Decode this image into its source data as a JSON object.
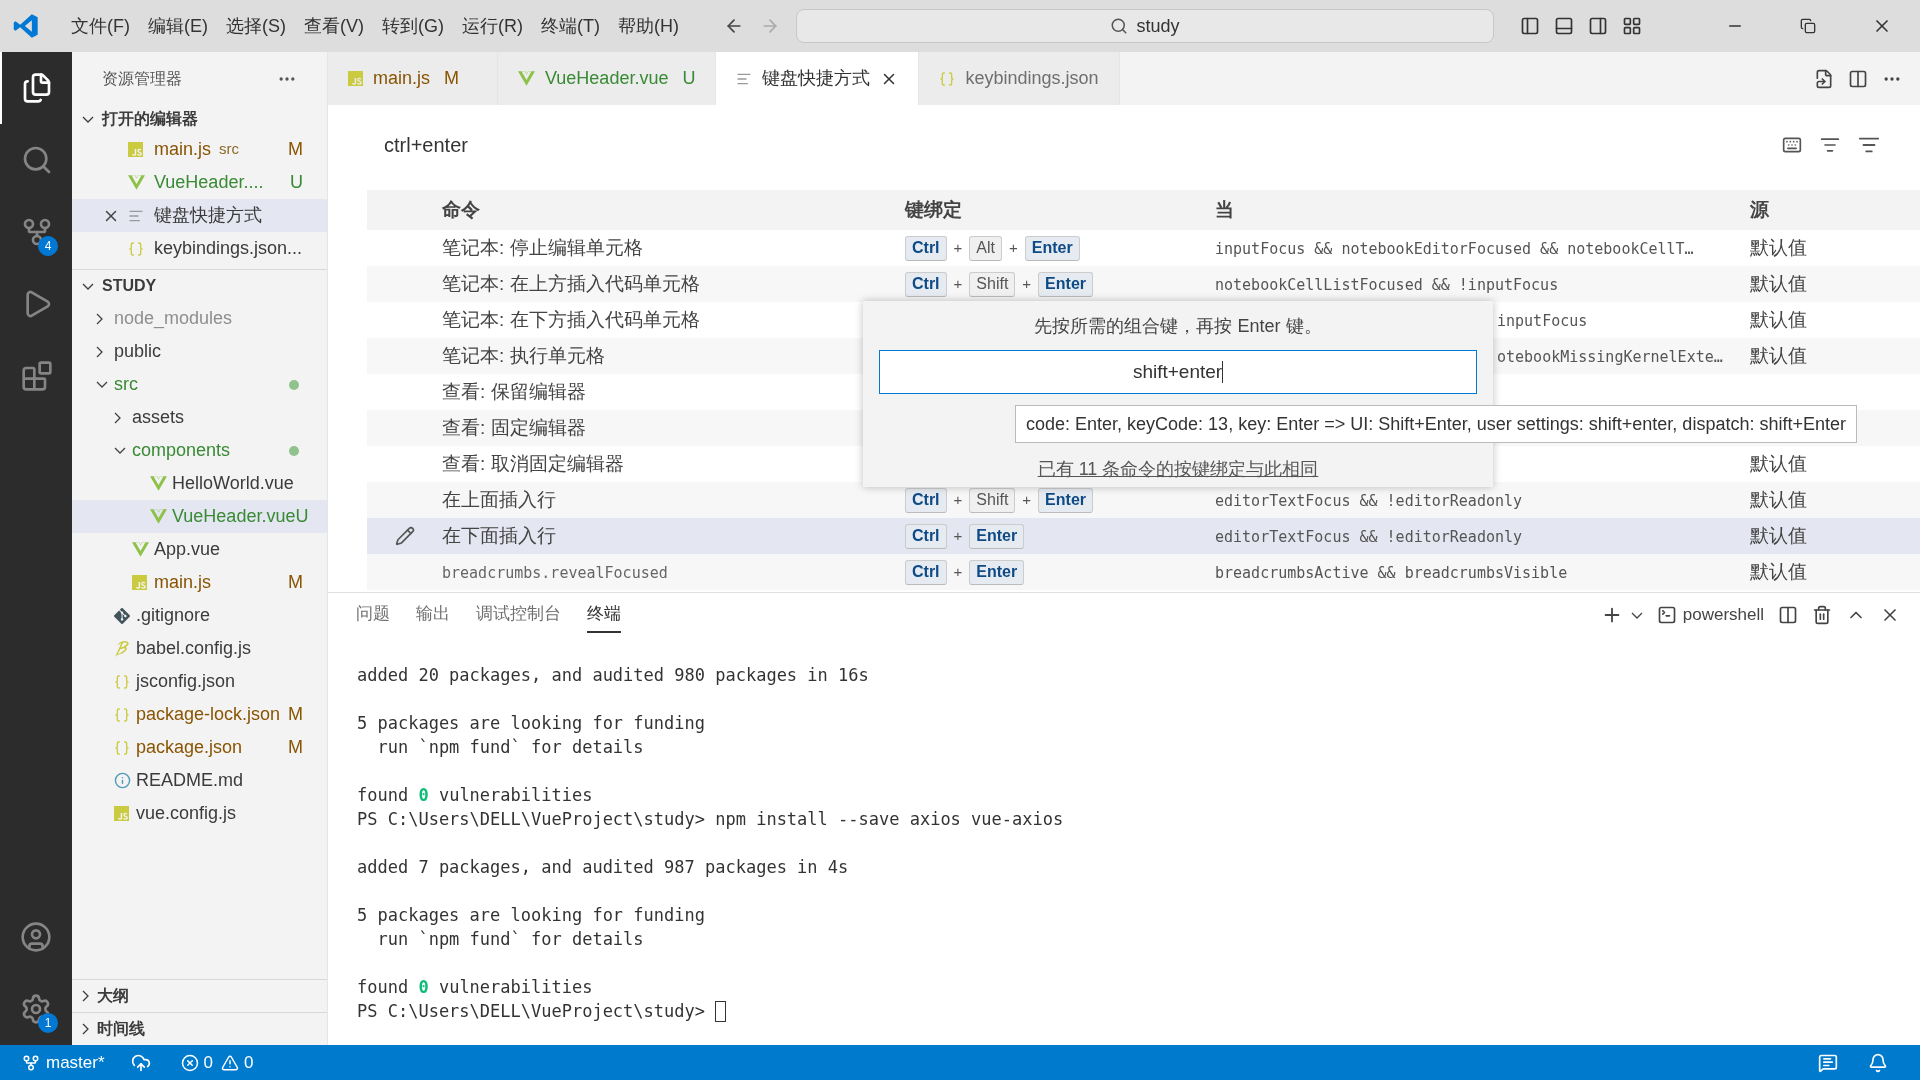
{
  "title_bar": {
    "menus": [
      "文件(F)",
      "编辑(E)",
      "选择(S)",
      "查看(V)",
      "转到(G)",
      "运行(R)",
      "终端(T)",
      "帮助(H)"
    ],
    "search": "study"
  },
  "activity_bar": {
    "items": [
      {
        "kind": "files",
        "selected": true
      },
      {
        "kind": "search",
        "selected": false
      },
      {
        "kind": "source-control",
        "selected": false,
        "badge": "4"
      },
      {
        "kind": "run",
        "selected": false
      },
      {
        "kind": "extensions",
        "selected": false
      }
    ],
    "bottom": [
      {
        "kind": "account"
      },
      {
        "kind": "settings",
        "badge": "1"
      }
    ]
  },
  "sidebar": {
    "title": "资源管理器",
    "open_editors": {
      "title": "打开的编辑器",
      "expanded": true,
      "items": [
        {
          "name": "main.js",
          "kind": "js",
          "description": "src",
          "badge": "M",
          "color": "#895503",
          "selected": false
        },
        {
          "name": "VueHeader....",
          "kind": "vue",
          "badge": "U",
          "color": "#388a34",
          "selected": false
        },
        {
          "name": "键盘快捷方式",
          "kind": "preview",
          "selected": true
        },
        {
          "name": "keybindings.json...",
          "kind": "json",
          "selected": false
        }
      ]
    },
    "workspace": {
      "title": "STUDY",
      "expanded": true,
      "items": [
        {
          "name": "node_modules",
          "kind": "folder",
          "expanded": false,
          "color": "#8e8e90",
          "selected": false
        },
        {
          "name": "public",
          "kind": "folder",
          "expanded": false,
          "selected": false
        },
        {
          "name": "src",
          "kind": "folder",
          "expanded": true,
          "color": "#388a34",
          "changes_dot": true,
          "selected": false,
          "children": [
            {
              "name": "assets",
              "kind": "folder",
              "expanded": false,
              "selected": false
            },
            {
              "name": "components",
              "kind": "folder",
              "expanded": true,
              "color": "#388a34",
              "changes_dot": true,
              "selected": false,
              "children": [
                {
                  "name": "HelloWorld.vue",
                  "kind": "vue",
                  "selected": false
                },
                {
                  "name": "VueHeader.vue",
                  "kind": "vue",
                  "badge": "U",
                  "color": "#388a34",
                  "selected": true
                }
              ]
            },
            {
              "name": "App.vue",
              "kind": "vue",
              "selected": false
            },
            {
              "name": "main.js",
              "kind": "js",
              "badge": "M",
              "color": "#895503",
              "selected": false
            }
          ]
        },
        {
          "name": ".gitignore",
          "kind": "git",
          "selected": false
        },
        {
          "name": "babel.config.js",
          "kind": "babel",
          "selected": false
        },
        {
          "name": "jsconfig.json",
          "kind": "json",
          "selected": false
        },
        {
          "name": "package-lock.json",
          "kind": "json",
          "badge": "M",
          "color": "#895503",
          "selected": false
        },
        {
          "name": "package.json",
          "kind": "json",
          "badge": "M",
          "color": "#895503",
          "selected": false
        },
        {
          "name": "README.md",
          "kind": "info",
          "selected": false
        },
        {
          "name": "vue.config.js",
          "kind": "js",
          "selected": false
        }
      ]
    },
    "sections": [
      {
        "title": "大纲",
        "expanded": false
      },
      {
        "title": "时间线",
        "expanded": false
      }
    ]
  },
  "tabs": [
    {
      "label": "main.js",
      "kind": "js",
      "badge": "M",
      "color": "#895503",
      "selected": false
    },
    {
      "label": "VueHeader.vue",
      "kind": "vue",
      "badge": "U",
      "color": "#388a34",
      "selected": false
    },
    {
      "label": "键盘快捷方式",
      "kind": "preview",
      "selected": true
    },
    {
      "label": "keybindings.json",
      "kind": "json",
      "selected": false
    }
  ],
  "keybindings": {
    "search": "ctrl+enter",
    "columns": [
      "命令",
      "键绑定",
      "当",
      "源"
    ],
    "rows": [
      {
        "command": "笔记本: 停止编辑单元格",
        "kind": "title",
        "keys": [
          {
            "label": "Ctrl",
            "kind": "key",
            "matched": true
          },
          {
            "label": "+",
            "kind": "plus"
          },
          {
            "label": "Alt",
            "kind": "key",
            "matched": false
          },
          {
            "label": "+",
            "kind": "plus"
          },
          {
            "label": "Enter",
            "kind": "key",
            "matched": true
          }
        ],
        "when": "inputFocus && notebookEditorFocused && notebookCellT…",
        "source": "默认值",
        "selected": false,
        "covered": false
      },
      {
        "command": "笔记本: 在上方插入代码单元格",
        "kind": "title",
        "keys": [
          {
            "label": "Ctrl",
            "kind": "key",
            "matched": true
          },
          {
            "label": "+",
            "kind": "plus"
          },
          {
            "label": "Shift",
            "kind": "key",
            "matched": false
          },
          {
            "label": "+",
            "kind": "plus"
          },
          {
            "label": "Enter",
            "kind": "key",
            "matched": true
          }
        ],
        "when": "notebookCellListFocused && !inputFocus",
        "source": "默认值",
        "selected": false,
        "covered": false
      },
      {
        "command": "笔记本: 在下方插入代码单元格",
        "kind": "title",
        "when": "inputFocus",
        "source": "默认值",
        "selected": false,
        "covered": true
      },
      {
        "command": "笔记本: 执行单元格",
        "kind": "title",
        "when": "otebookMissingKernelExte…",
        "source": "默认值",
        "selected": false,
        "covered": true
      },
      {
        "command": "查看: 保留编辑器",
        "kind": "title",
        "selected": false
      },
      {
        "command": "查看: 固定编辑器",
        "kind": "title",
        "selected": false
      },
      {
        "command": "查看: 取消固定编辑器",
        "kind": "title",
        "source": "默认值",
        "selected": false
      },
      {
        "command": "在上面插入行",
        "kind": "title",
        "keys": [
          {
            "label": "Ctrl",
            "kind": "key",
            "matched": true
          },
          {
            "label": "+",
            "kind": "plus"
          },
          {
            "label": "Shift",
            "kind": "key",
            "matched": false
          },
          {
            "label": "+",
            "kind": "plus"
          },
          {
            "label": "Enter",
            "kind": "key",
            "matched": true
          }
        ],
        "when": "editorTextFocus && !editorReadonly",
        "source": "默认值",
        "selected": false,
        "covered": false
      },
      {
        "command": "在下面插入行",
        "kind": "title",
        "keys": [
          {
            "label": "Ctrl",
            "kind": "key",
            "matched": true
          },
          {
            "label": "+",
            "kind": "plus"
          },
          {
            "label": "Enter",
            "kind": "key",
            "matched": true
          }
        ],
        "when": "editorTextFocus && !editorReadonly",
        "source": "默认值",
        "selected": true,
        "covered": false
      },
      {
        "command": "breadcrumbs.revealFocused",
        "kind": "id",
        "keys": [
          {
            "label": "Ctrl",
            "kind": "key",
            "matched": true
          },
          {
            "label": "+",
            "kind": "plus"
          },
          {
            "label": "Enter",
            "kind": "key",
            "matched": true
          }
        ],
        "when": "breadcrumbsActive && breadcrumbsVisible",
        "source": "默认值",
        "selected": false,
        "covered": false
      }
    ]
  },
  "dialog": {
    "prompt": "先按所需的组合键，再按 Enter 键。",
    "value": "shift+enter",
    "tooltip": "code: Enter, keyCode: 13, key: Enter => UI: Shift+Enter, user settings: shift+enter, dispatch: shift+Enter",
    "link": "已有 11 条命令的按键绑定与此相同"
  },
  "panel": {
    "tabs": [
      {
        "label": "问题",
        "selected": false
      },
      {
        "label": "输出",
        "selected": false
      },
      {
        "label": "调试控制台",
        "selected": false
      },
      {
        "label": "终端",
        "selected": true
      }
    ],
    "shell": "powershell",
    "lines": [
      {
        "kind": "blank"
      },
      {
        "kind": "text",
        "segments": [
          {
            "text": "added 20 packages, and audited 980 packages in 16s"
          }
        ]
      },
      {
        "kind": "blank"
      },
      {
        "kind": "text",
        "segments": [
          {
            "text": "5 packages are looking for funding"
          }
        ]
      },
      {
        "kind": "text",
        "segments": [
          {
            "text": "  run `npm fund` for details"
          }
        ]
      },
      {
        "kind": "blank"
      },
      {
        "kind": "text",
        "segments": [
          {
            "text": "found "
          },
          {
            "text": "0",
            "kind": "success"
          },
          {
            "text": " vulnerabilities"
          }
        ]
      },
      {
        "kind": "text",
        "segments": [
          {
            "text": "PS C:\\Users\\DELL\\VueProject\\study> npm install --save axios vue-axios"
          }
        ]
      },
      {
        "kind": "blank"
      },
      {
        "kind": "text",
        "segments": [
          {
            "text": "added 7 packages, and audited 987 packages in 4s"
          }
        ]
      },
      {
        "kind": "blank"
      },
      {
        "kind": "text",
        "segments": [
          {
            "text": "5 packages are looking for funding"
          }
        ]
      },
      {
        "kind": "text",
        "segments": [
          {
            "text": "  run `npm fund` for details"
          }
        ]
      },
      {
        "kind": "blank"
      },
      {
        "kind": "text",
        "segments": [
          {
            "text": "found "
          },
          {
            "text": "0",
            "kind": "success"
          },
          {
            "text": " vulnerabilities"
          }
        ]
      },
      {
        "kind": "text",
        "segments": [
          {
            "text": "PS C:\\Users\\DELL\\VueProject\\study> "
          }
        ],
        "cursor": true
      }
    ]
  },
  "status_bar": {
    "branch": "master*",
    "errors": "0",
    "warnings": "0"
  }
}
